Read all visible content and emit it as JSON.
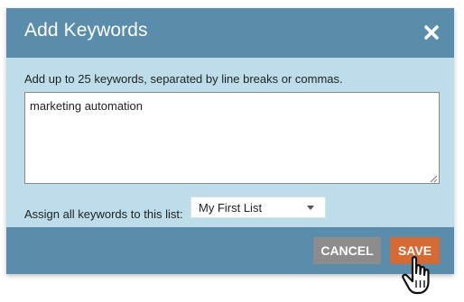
{
  "dialog": {
    "title": "Add Keywords",
    "close_icon": "close-x-icon",
    "instructions": "Add up to 25 keywords, separated by line breaks or commas.",
    "keywords_value": "marketing automation",
    "assign_label": "Assign all keywords to this list:",
    "list_select": {
      "selected": "My First List",
      "caret_icon": "caret-down-icon"
    },
    "buttons": {
      "cancel": "CANCEL",
      "save": "SAVE"
    }
  },
  "colors": {
    "header": "#5a8cac",
    "body": "#bcdde9",
    "cancel": "#8c8c8c",
    "save": "#d56a32"
  },
  "cursor_icon": "hand-pointer-icon"
}
